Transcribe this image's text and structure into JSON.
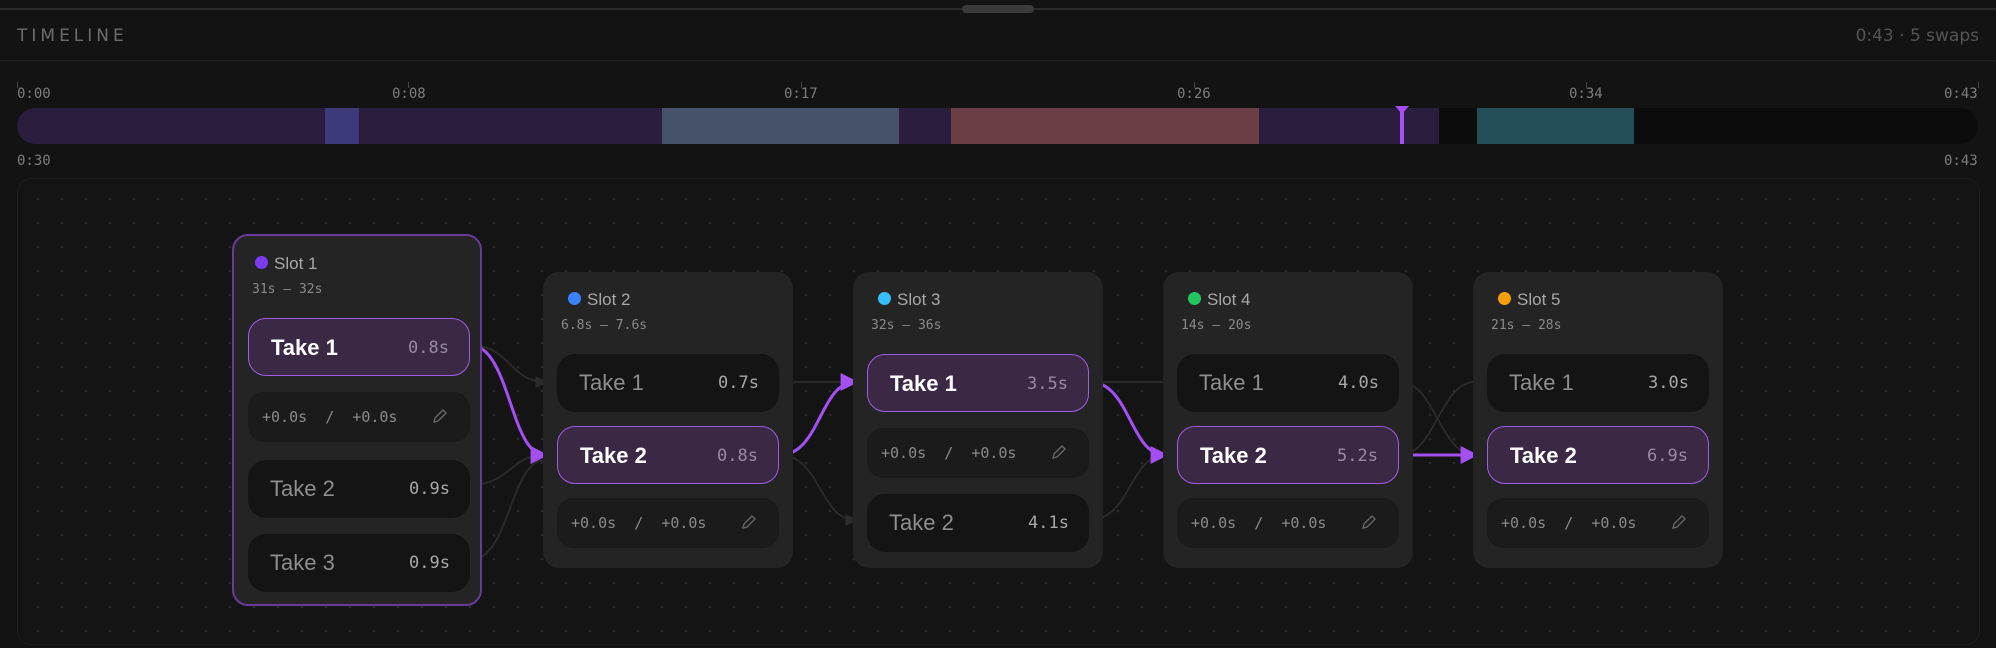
{
  "header": {
    "title": "TIMELINE",
    "meta": "0:43 · 5 swaps"
  },
  "ruler": {
    "ticks": [
      "0:00",
      "0:08",
      "0:17",
      "0:26",
      "0:34",
      "0:43"
    ]
  },
  "range": {
    "start": "0:30",
    "end": "0:43"
  },
  "slots": [
    {
      "title": "Slot 1",
      "range": "31s – 32s",
      "color": "#7c3aed",
      "takes": [
        {
          "name": "Take 1",
          "dur": "0.8s",
          "selected": true
        },
        {
          "name": "Take 2",
          "dur": "0.9s",
          "selected": false
        },
        {
          "name": "Take 3",
          "dur": "0.9s",
          "selected": false
        }
      ],
      "offset": {
        "a": "+0.0s",
        "sep": "/",
        "b": "+0.0s"
      }
    },
    {
      "title": "Slot 2",
      "range": "6.8s – 7.6s",
      "color": "#3b82f6",
      "takes": [
        {
          "name": "Take 1",
          "dur": "0.7s",
          "selected": false
        },
        {
          "name": "Take 2",
          "dur": "0.8s",
          "selected": true
        }
      ],
      "offset": {
        "a": "+0.0s",
        "sep": "/",
        "b": "+0.0s"
      }
    },
    {
      "title": "Slot 3",
      "range": "32s – 36s",
      "color": "#38bdf8",
      "takes": [
        {
          "name": "Take 1",
          "dur": "3.5s",
          "selected": true
        },
        {
          "name": "Take 2",
          "dur": "4.1s",
          "selected": false
        }
      ],
      "offset": {
        "a": "+0.0s",
        "sep": "/",
        "b": "+0.0s"
      }
    },
    {
      "title": "Slot 4",
      "range": "14s – 20s",
      "color": "#22c55e",
      "takes": [
        {
          "name": "Take 1",
          "dur": "4.0s",
          "selected": false
        },
        {
          "name": "Take 2",
          "dur": "5.2s",
          "selected": true
        }
      ],
      "offset": {
        "a": "+0.0s",
        "sep": "/",
        "b": "+0.0s"
      }
    },
    {
      "title": "Slot 5",
      "range": "21s – 28s",
      "color": "#f59e0b",
      "takes": [
        {
          "name": "Take 1",
          "dur": "3.0s",
          "selected": false
        },
        {
          "name": "Take 2",
          "dur": "6.9s",
          "selected": true
        }
      ],
      "offset": {
        "a": "+0.0s",
        "sep": "/",
        "b": "+0.0s"
      }
    }
  ],
  "colors": {
    "accent": "#a44ff2",
    "segments": [
      "#2b1d3e",
      "#3d3a7a",
      "#2b1d3e",
      "#45526a",
      "#2b1d3e",
      "#6b3e45",
      "#2b1d3e",
      "#0c0c0c",
      "#244f5a"
    ]
  },
  "icons": {
    "pencil": "pencil-icon",
    "handle": "drag-handle-icon"
  }
}
